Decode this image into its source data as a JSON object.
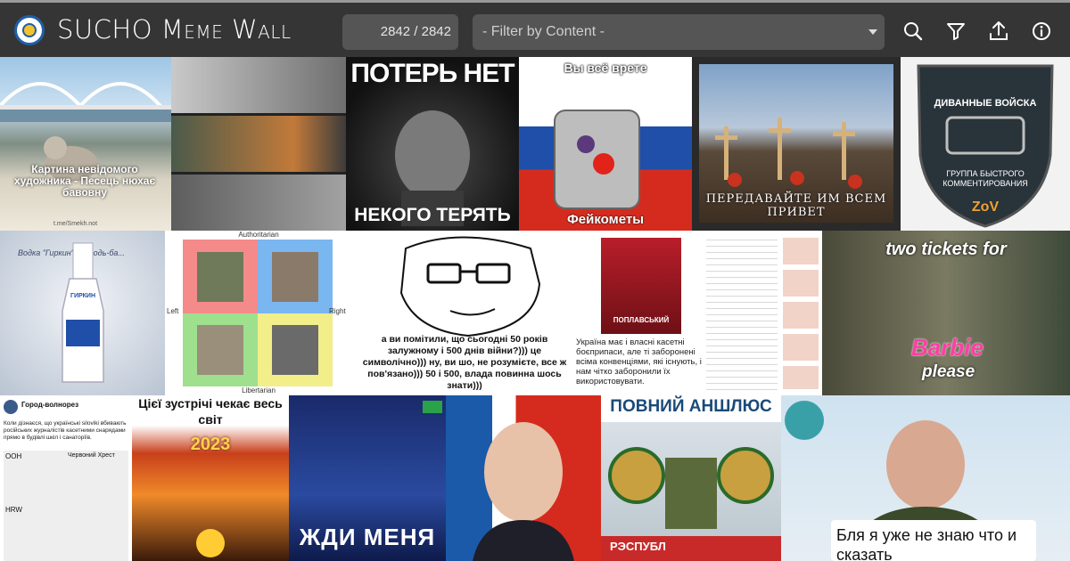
{
  "header": {
    "title": "SUCHO Meme Wall",
    "counter": "2842 / 2842",
    "filter_placeholder": "- Filter by Content -",
    "icons": [
      "search-icon",
      "filter-icon",
      "upload-icon",
      "info-icon"
    ]
  },
  "colors": {
    "header_bg": "#353535",
    "field_bg": "#555555",
    "text": "#ffffff"
  },
  "memes": {
    "m1_caption": "Картина невідомого художника - Песець нюхає бавовну",
    "m1_watermark": "t.me/Smekh.not",
    "m3_top": "ПОТЕРЬ НЕТ",
    "m3_bottom": "НЕКОГО ТЕРЯТЬ",
    "m4_top": "Вы всё врете",
    "m4_bottom": "Фейкометы",
    "m5_caption": "ПЕРЕДАВАЙТЕ ИМ ВСЕМ ПРИВЕТ",
    "m6_top": "ДИВАННЫЕ ВОЙСКА",
    "m6_mid": "ГРУППА БЫСТРОГО КОММЕНТИРОВАНИЯ",
    "m6_bottom": "ZoV",
    "m7_caption": "Водка \"Гиркин\" пригодь-ба...",
    "m7_label": "ГИРКИН",
    "m8_top": "Authoritarian",
    "m8_left": "Left",
    "m8_right": "Right",
    "m8_bottom": "Libertarian",
    "m9_caption": "а ви помітили, що сьогодні 50 років залужному і 500 днів війни?))) це символічно))) ну, ви шо, не розумієте, все ж пов'язано))) 50 і 500, влада повинна шось знати)))",
    "m10_name": "ПОПЛАВСЬКИЙ",
    "m10_caption": "Україна має і власні касетні боєприпаси, але ті заборонені всіма конвенціями, які існують, і нам чітко заборонили їх використовувати.",
    "m11_top": "two tickets for",
    "m11_barbie": "Barbie",
    "m11_bottom": "please",
    "m12_channel": "Город-волнорез",
    "m12_caption": "Коли дізнаєся, що українські siloviki вбивають російських журналістів касетними снарядами прямо в будівлі шкіл і санаторіїв.",
    "m12_l1": "ООН",
    "m12_l2": "Червоний Хрест",
    "m12_l3": "HRW",
    "m13_top": "Цієї зустрічі чекає весь світ",
    "m13_year": "2023",
    "m14_caption": "ЖДИ МЕНЯ",
    "m16_top": "ПОВНИЙ АНШЛЮС",
    "m16_banner": "РЭСПУБЛ",
    "m17_caption": "Бля я уже не знаю что и сказать"
  }
}
